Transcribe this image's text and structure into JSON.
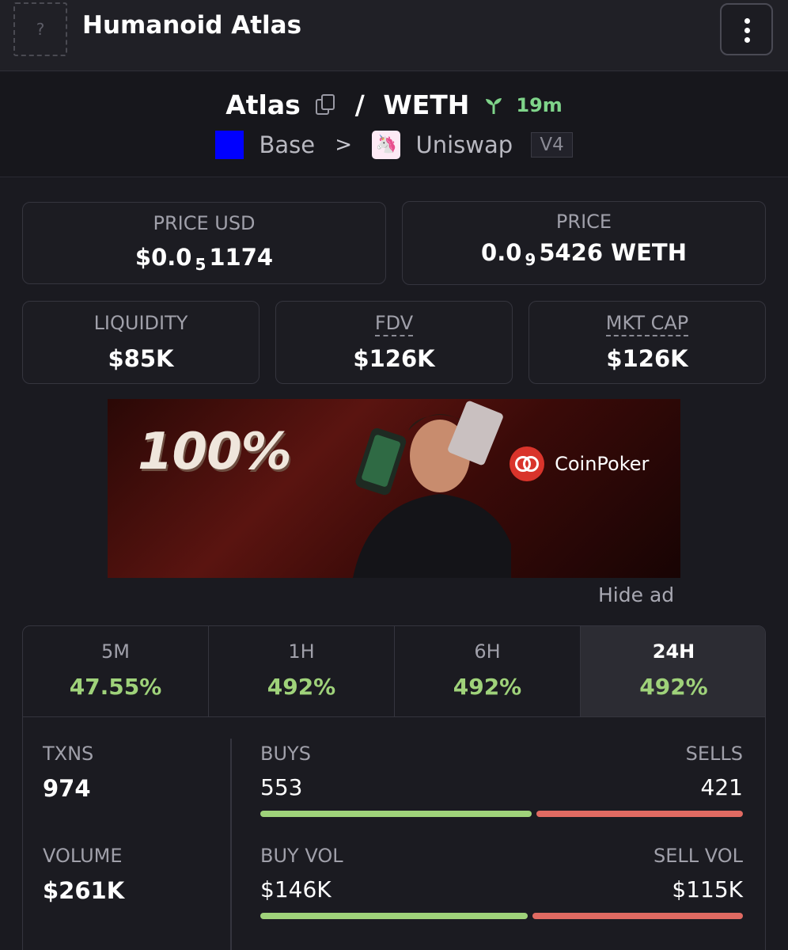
{
  "header": {
    "title": "Humanoid Atlas",
    "token_icon_placeholder": "?"
  },
  "pair": {
    "base": "Atlas",
    "separator": "/",
    "quote": "WETH",
    "age": "19m",
    "chain": "Base",
    "chain_color": "#0000ff",
    "breadcrumb_separator": ">",
    "dex": "Uniswap",
    "version": "V4"
  },
  "stats": {
    "price_usd": {
      "label": "PRICE USD",
      "prefix": "$0.0",
      "zeros": "5",
      "digits": "1174"
    },
    "price": {
      "label": "PRICE",
      "prefix": "0.0",
      "zeros": "9",
      "digits": "5426 WETH"
    },
    "liquidity": {
      "label": "LIQUIDITY",
      "value": "$85K"
    },
    "fdv": {
      "label": "FDV",
      "value": "$126K"
    },
    "mkt_cap": {
      "label": "MKT CAP",
      "value": "$126K"
    }
  },
  "ad": {
    "headline": "100%",
    "brand": "CoinPoker",
    "hide_label": "Hide ad"
  },
  "timeframes": [
    {
      "label": "5M",
      "value": "47.55%"
    },
    {
      "label": "1H",
      "value": "492%"
    },
    {
      "label": "6H",
      "value": "492%"
    },
    {
      "label": "24H",
      "value": "492%",
      "active": true
    }
  ],
  "metrics": {
    "txns": {
      "label": "TXNS",
      "value": "974"
    },
    "buys": {
      "label": "BUYS",
      "value": "553"
    },
    "sells": {
      "label": "SELLS",
      "value": "421"
    },
    "volume": {
      "label": "VOLUME",
      "value": "$261K"
    },
    "buy_vol": {
      "label": "BUY VOL",
      "value": "$146K"
    },
    "sell_vol": {
      "label": "SELL VOL",
      "value": "$115K"
    },
    "buy_ratio": 0.568,
    "buy_vol_ratio": 0.559
  },
  "colors": {
    "positive": "#9fd27a",
    "negative": "#e06a62",
    "age_green": "#7fd48a"
  }
}
